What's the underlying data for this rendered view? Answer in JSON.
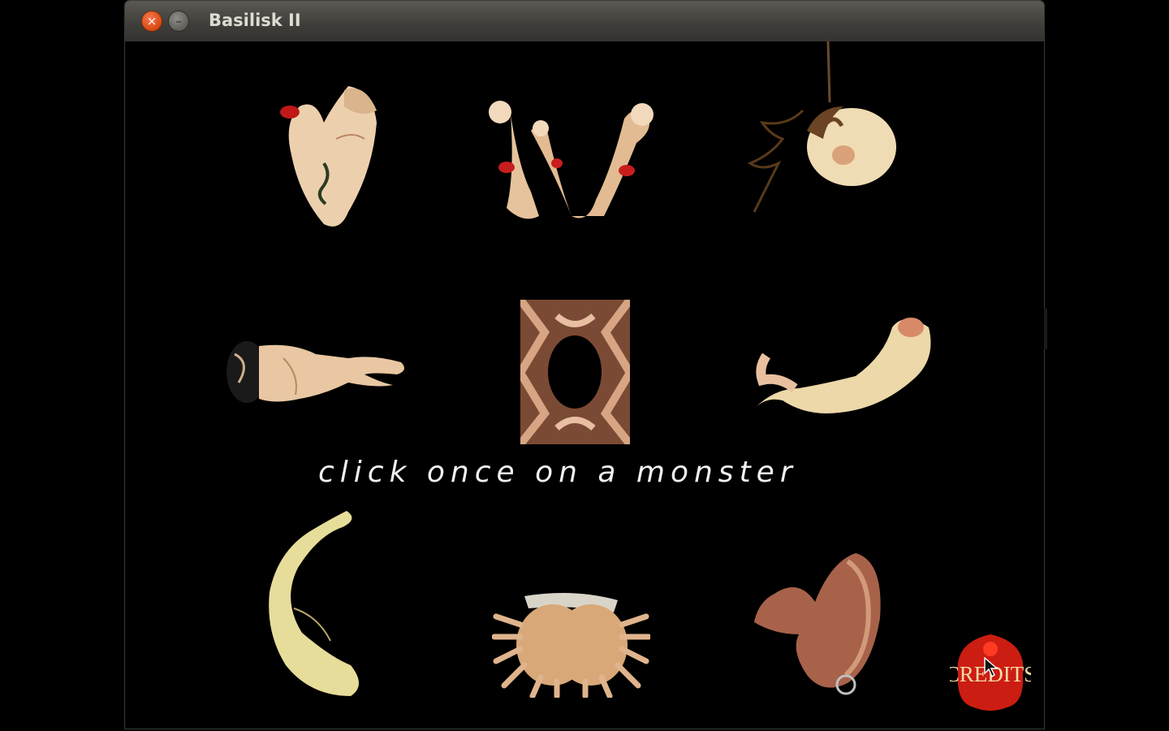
{
  "window": {
    "title": "Basilisk II"
  },
  "titlebar": {
    "close_icon": "close-icon",
    "minimize_icon": "minimize-icon"
  },
  "stage": {
    "prompt": "click once on a monster",
    "monsters": [
      {
        "name": "monster-1"
      },
      {
        "name": "monster-2"
      },
      {
        "name": "monster-3"
      },
      {
        "name": "monster-4"
      },
      {
        "name": "monster-5"
      },
      {
        "name": "monster-6"
      },
      {
        "name": "monster-7"
      },
      {
        "name": "monster-8"
      },
      {
        "name": "monster-9"
      }
    ],
    "credits_label": "CREDITS"
  },
  "colors": {
    "background": "#000000",
    "skin": "#e8c9a0",
    "accent_red": "#d01818",
    "titlebar": "#3e3d39"
  }
}
